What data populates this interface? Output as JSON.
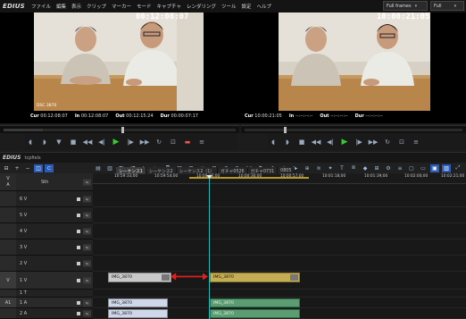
{
  "app": {
    "logo": "EDIUS",
    "menu": [
      "ファイル",
      "編集",
      "表示",
      "クリップ",
      "マーカー",
      "モード",
      "キャプチャ",
      "レンダリング",
      "ツール",
      "設定",
      "ヘルプ"
    ],
    "frames_dropdown": "Full frames",
    "view_dropdown": "Full"
  },
  "player": {
    "timecode": "00:12:08:07",
    "cur_label": "Cur",
    "cur": "00:12:08:07",
    "in_label": "In",
    "in": "00:12:08:07",
    "out_label": "Out",
    "out": "00:12:15:24",
    "dur_label": "Dur",
    "dur": "00:00:07:17",
    "overlay": "DSC 3870"
  },
  "recorder": {
    "timecode": "10:00:21:05",
    "cur_label": "Cur",
    "cur": "10:00:21:05",
    "in_label": "In",
    "in": "--:--:--:--",
    "out_label": "Out",
    "out": "--:--:--:--",
    "dur_label": "Dur",
    "dur": "--:--:--:--"
  },
  "timeline": {
    "logo": "EDIUS",
    "project": "tcpfiels",
    "tabs": [
      "シーケンス1",
      "シーケンス2",
      "シーケンス2（1）",
      "ガチャ0526",
      "ガチャ0731",
      "0805"
    ],
    "ruler": [
      "10:59:33;00",
      "10:59:54;00",
      "10:00:15;00",
      "10:00:36;00",
      "10:00:57;00",
      "10:01:18;00",
      "10:01:39;00",
      "10:02:00;00",
      "10:02:21;00"
    ],
    "tracks": [
      {
        "label": "6 V",
        "name": ""
      },
      {
        "label": "5 V",
        "name": ""
      },
      {
        "label": "4 V",
        "name": ""
      },
      {
        "label": "3 V",
        "name": ""
      },
      {
        "label": "2 V",
        "name": ""
      },
      {
        "label": "1 V",
        "name": "V"
      },
      {
        "label": "1 T",
        "name": ""
      },
      {
        "label": "1 A",
        "name": "A1"
      },
      {
        "label": "2 A",
        "name": ""
      }
    ],
    "header_va": "V\nA",
    "header_ch": "Sth",
    "clip_a": "IMG_3870",
    "clip_b": "IMG_3870",
    "audio_a1": "IMG_3870",
    "audio_a2": "IMG_3870",
    "audio_b1": "IMG_3870",
    "audio_b2": "IMG_3870"
  },
  "colors": {
    "playhead": "#2fb7b7",
    "clip_video_b": "#c5ad55",
    "clip_audio_b": "#5b9c72",
    "arrow": "#e02020"
  }
}
